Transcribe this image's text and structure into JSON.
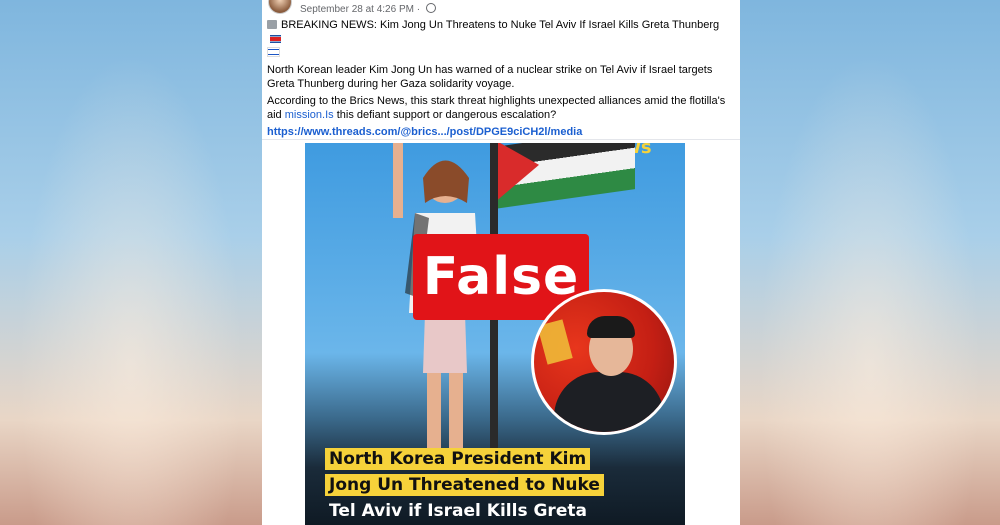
{
  "post": {
    "timestamp": "September 28 at 4:26 PM",
    "separator": " · ",
    "headline": "BREAKING NEWS: Kim Jong Un Threatens to Nuke Tel Aviv If Israel Kills Greta Thunberg",
    "paragraph1": "North Korean leader Kim Jong Un has warned of a nuclear strike on Tel Aviv if Israel targets Greta Thunberg during her Gaza solidarity voyage.",
    "paragraph2_before": "According to the Brics News, this stark threat highlights unexpected alliances amid the flotilla's aid ",
    "paragraph2_link": "mission.Is",
    "paragraph2_after": " this defiant support or dangerous escalation?",
    "url": "https://www.threads.com/@brics.../post/DPGE9ciCH2l/media"
  },
  "image": {
    "news_tag": "News",
    "stamp": "False",
    "caption": [
      "North Korea President Kim",
      "Jong Un Threatened to Nuke",
      "Tel Aviv if Israel Kills Greta"
    ]
  },
  "colors": {
    "stamp": "#e11418",
    "caption_highlight": "#f6d23a",
    "link": "#1b5fd0"
  }
}
